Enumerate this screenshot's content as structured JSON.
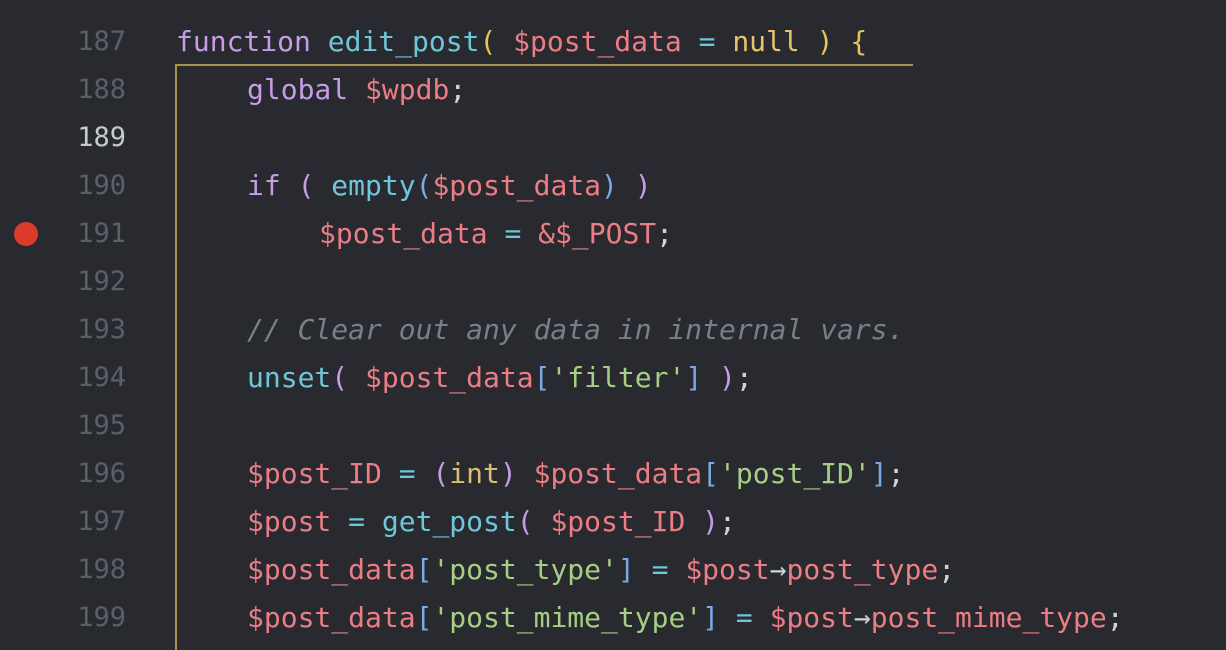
{
  "gutter": {
    "lines": [
      {
        "number": "187"
      },
      {
        "number": "188"
      },
      {
        "number": "189",
        "current": true
      },
      {
        "number": "190"
      },
      {
        "number": "191",
        "breakpoint": true
      },
      {
        "number": "192"
      },
      {
        "number": "193"
      },
      {
        "number": "194"
      },
      {
        "number": "195"
      },
      {
        "number": "196"
      },
      {
        "number": "197"
      },
      {
        "number": "198"
      },
      {
        "number": "199"
      }
    ]
  },
  "code": {
    "l187": {
      "kw_function": "function",
      "fn_name": "edit_post",
      "open": "(",
      "param": "$post_data",
      "eq": "=",
      "null": "null",
      "close": ")",
      "brace": "{"
    },
    "l188": {
      "kw_global": "global",
      "var": "$wpdb",
      "semi": ";"
    },
    "l190": {
      "kw_if": "if",
      "open": "(",
      "fn_empty": "empty",
      "inner_open": "(",
      "var": "$post_data",
      "inner_close": ")",
      "close": ")"
    },
    "l191": {
      "var": "$post_data",
      "eq": "=",
      "amp": "&",
      "post": "$_POST",
      "semi": ";"
    },
    "l193": {
      "comment": "// Clear out any data in internal vars."
    },
    "l194": {
      "fn_unset": "unset",
      "open": "(",
      "var": "$post_data",
      "bracket_open": "[",
      "str": "'filter'",
      "bracket_close": "]",
      "close": ")",
      "semi": ";"
    },
    "l196": {
      "var": "$post_ID",
      "eq": "=",
      "cast_open": "(",
      "cast": "int",
      "cast_close": ")",
      "var2": "$post_data",
      "bracket_open": "[",
      "str": "'post_ID'",
      "bracket_close": "]",
      "semi": ";"
    },
    "l197": {
      "var": "$post",
      "eq": "=",
      "fn_get_post": "get_post",
      "open": "(",
      "arg": "$post_ID",
      "close": ")",
      "semi": ";"
    },
    "l198": {
      "var": "$post_data",
      "bracket_open": "[",
      "str": "'post_type'",
      "bracket_close": "]",
      "eq": "=",
      "var2": "$post",
      "arrow": "→",
      "prop": "post_type",
      "semi": ";"
    },
    "l199": {
      "var": "$post_data",
      "bracket_open": "[",
      "str": "'post_mime_type'",
      "bracket_close": "]",
      "eq": "=",
      "var2": "$post",
      "arrow": "→",
      "prop": "post_mime_type",
      "semi": ";"
    }
  },
  "colors": {
    "background": "#282a2f",
    "breakpoint": "#dd3b2a",
    "block_outline": "#a8904e"
  }
}
